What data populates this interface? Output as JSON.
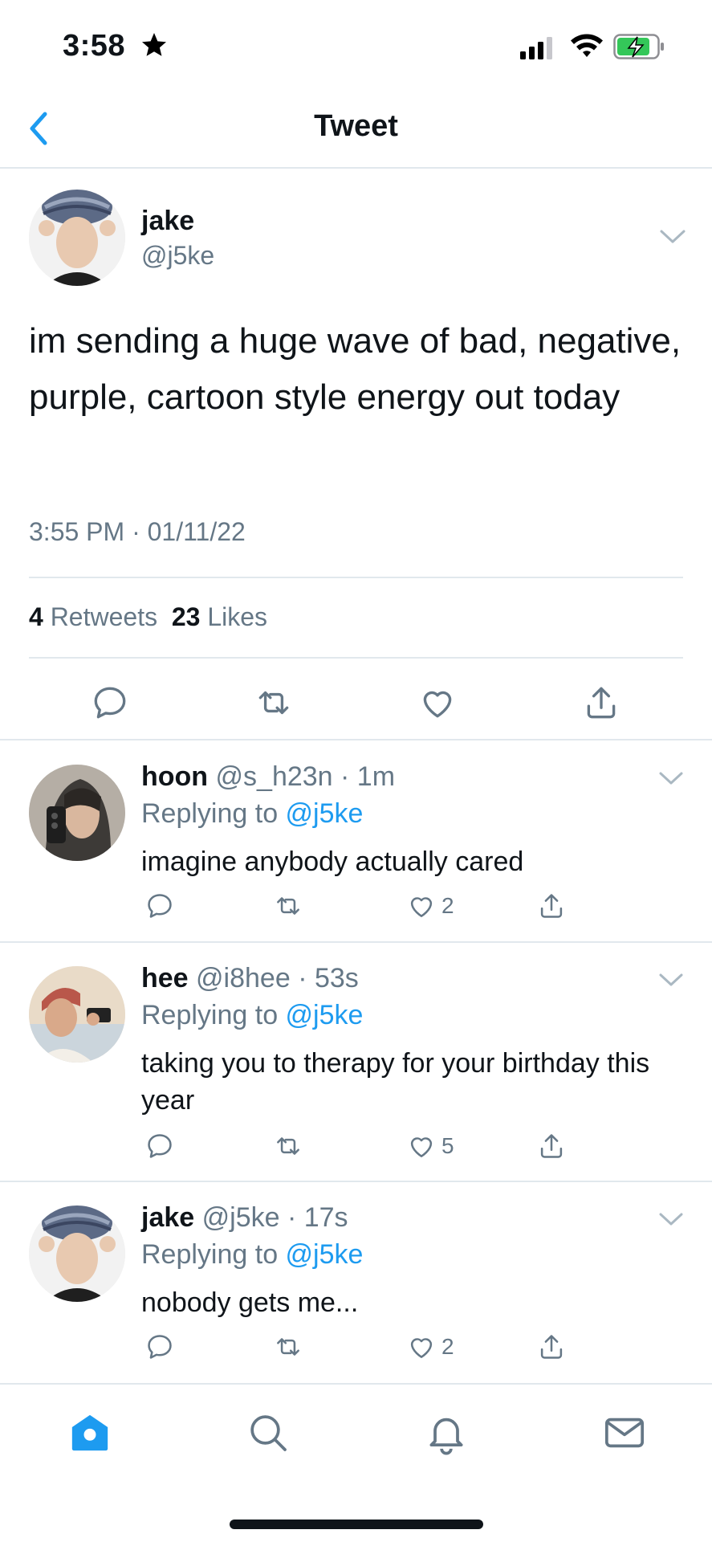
{
  "status_bar": {
    "time": "3:58"
  },
  "nav": {
    "title": "Tweet"
  },
  "main_tweet": {
    "name": "jake",
    "handle": "@j5ke",
    "text": "im sending a huge wave of bad, negative, purple, cartoon style energy out today",
    "timestamp": "3:55 PM · 01/11/22",
    "retweets_count": "4",
    "retweets_label": "Retweets",
    "likes_count": "23",
    "likes_label": "Likes"
  },
  "replies": [
    {
      "name": "hoon",
      "meta": "@s_h23n · 1m",
      "replying_prefix": "Replying to ",
      "replying_to": "@j5ke",
      "text": "imagine anybody actually cared",
      "likes": "2"
    },
    {
      "name": "hee",
      "meta": "@i8hee · 53s",
      "replying_prefix": "Replying to ",
      "replying_to": "@j5ke",
      "text": "taking you to therapy for your birthday this year",
      "likes": "5"
    },
    {
      "name": "jake",
      "meta": "@j5ke · 17s",
      "replying_prefix": "Replying to ",
      "replying_to": "@j5ke",
      "text": "nobody gets me...",
      "likes": "2"
    }
  ],
  "icons": {
    "back": "chevron-left-icon",
    "reply": "comment-icon",
    "retweet": "retweet-icon",
    "like": "heart-icon",
    "share": "share-icon",
    "tabs": [
      "home-icon",
      "search-icon",
      "bell-icon",
      "mail-icon"
    ]
  },
  "colors": {
    "accent": "#1d9bf0",
    "secondary_text": "#657786",
    "border": "#e1e8ed",
    "battery_green": "#34c759"
  }
}
